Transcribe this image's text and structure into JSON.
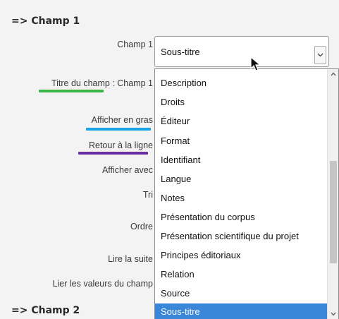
{
  "sections": {
    "champ1": "=> Champ 1",
    "champ2": "=> Champ 2"
  },
  "form": {
    "champ_label": "Champ 1",
    "titre_label": "Titre du champ : Champ 1",
    "gras_label": "Afficher en gras",
    "retour_label": "Retour à la ligne",
    "afficher_avec_label": "Afficher avec",
    "tri_label": "Tri",
    "ordre_label": "Ordre",
    "lire_suite_label": "Lire la suite",
    "lier_valeurs_label": "Lier les valeurs du champ"
  },
  "select": {
    "value": "Sous-titre"
  },
  "dropdown": {
    "options": [
      "Description",
      "Droits",
      "Éditeur",
      "Format",
      "Identifiant",
      "Langue",
      "Notes",
      "Présentation du corpus",
      "Présentation scientifique du projet",
      "Principes éditoriaux",
      "Relation",
      "Source",
      "Sous-titre"
    ],
    "selected_index": 12
  },
  "colors": {
    "underline_green": "#3cb54a",
    "underline_blue": "#1aa6e4",
    "underline_purple": "#6a2fa0",
    "selected_bg": "#3a86d8"
  },
  "icons": {
    "select_arrow": "chevron-down-icon",
    "cursor": "mouse-pointer-icon",
    "scroll_up": "chevron-up-icon",
    "scroll_down": "chevron-down-icon"
  }
}
